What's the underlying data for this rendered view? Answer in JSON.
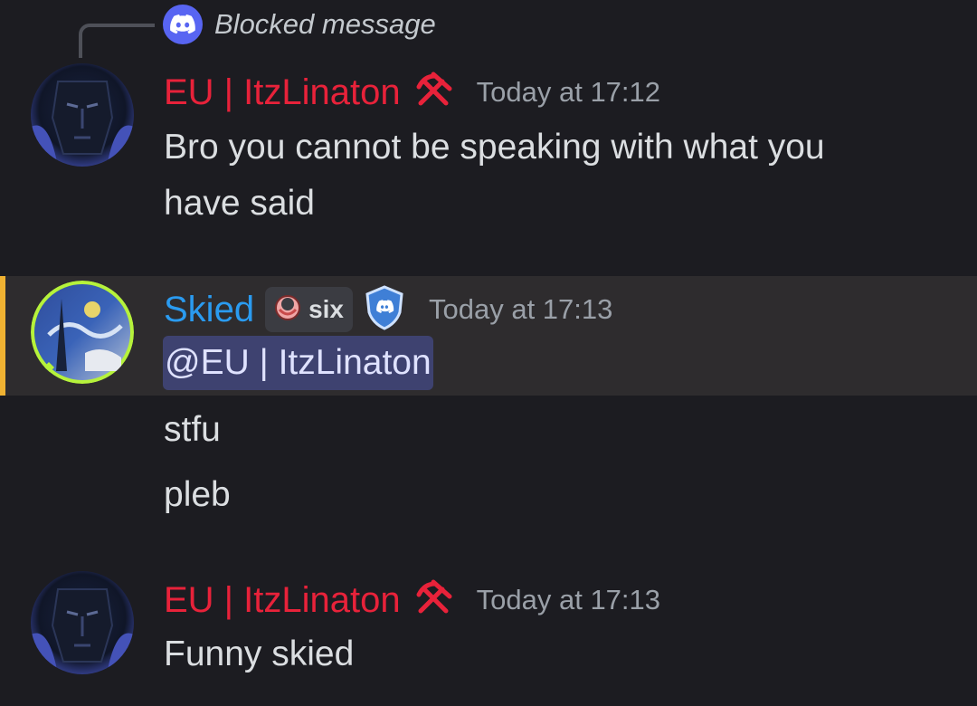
{
  "reply": {
    "text": "Blocked message",
    "icon": "discord-icon"
  },
  "messages": [
    {
      "author": "EU | ItzLinaton",
      "author_color": "#e8223a",
      "role_icon": "hammer-pick-icon",
      "timestamp": "Today at 17:12",
      "lines": [
        "Bro you cannot be speaking with what you",
        "have said"
      ]
    },
    {
      "author": "Skied",
      "author_color": "#2a9bf0",
      "guild_tag": "six",
      "guild_tag_icon": "ring-icon",
      "badge_icon": "discord-shield-icon",
      "timestamp": "Today at 17:13",
      "mention": "@EU | ItzLinaton",
      "followups": [
        "stfu",
        "pleb"
      ]
    },
    {
      "author": "EU | ItzLinaton",
      "author_color": "#e8223a",
      "role_icon": "hammer-pick-icon",
      "timestamp": "Today at 17:13",
      "lines": [
        "Funny skied"
      ]
    }
  ],
  "colors": {
    "background": "#1c1c21",
    "highlight_background": "#2e2c2e",
    "highlight_bar": "#f0b232",
    "mention_background": "#3e4270",
    "blurple": "#5865f2"
  }
}
